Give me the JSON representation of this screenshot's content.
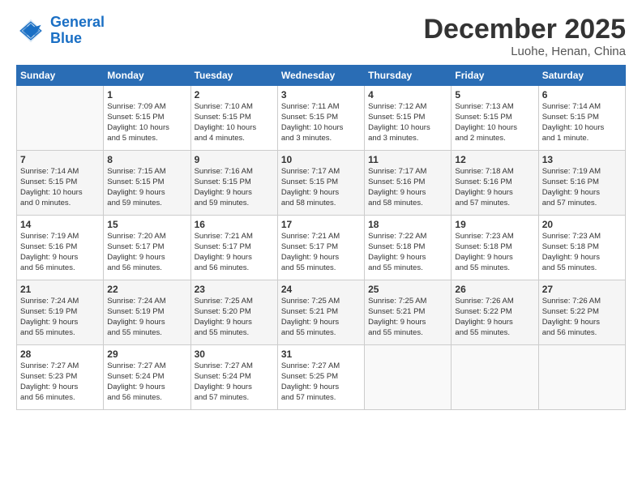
{
  "logo": {
    "line1": "General",
    "line2": "Blue"
  },
  "title": "December 2025",
  "subtitle": "Luohe, Henan, China",
  "weekdays": [
    "Sunday",
    "Monday",
    "Tuesday",
    "Wednesday",
    "Thursday",
    "Friday",
    "Saturday"
  ],
  "weeks": [
    [
      {
        "day": "",
        "info": ""
      },
      {
        "day": "1",
        "info": "Sunrise: 7:09 AM\nSunset: 5:15 PM\nDaylight: 10 hours\nand 5 minutes."
      },
      {
        "day": "2",
        "info": "Sunrise: 7:10 AM\nSunset: 5:15 PM\nDaylight: 10 hours\nand 4 minutes."
      },
      {
        "day": "3",
        "info": "Sunrise: 7:11 AM\nSunset: 5:15 PM\nDaylight: 10 hours\nand 3 minutes."
      },
      {
        "day": "4",
        "info": "Sunrise: 7:12 AM\nSunset: 5:15 PM\nDaylight: 10 hours\nand 3 minutes."
      },
      {
        "day": "5",
        "info": "Sunrise: 7:13 AM\nSunset: 5:15 PM\nDaylight: 10 hours\nand 2 minutes."
      },
      {
        "day": "6",
        "info": "Sunrise: 7:14 AM\nSunset: 5:15 PM\nDaylight: 10 hours\nand 1 minute."
      }
    ],
    [
      {
        "day": "7",
        "info": "Sunrise: 7:14 AM\nSunset: 5:15 PM\nDaylight: 10 hours\nand 0 minutes."
      },
      {
        "day": "8",
        "info": "Sunrise: 7:15 AM\nSunset: 5:15 PM\nDaylight: 9 hours\nand 59 minutes."
      },
      {
        "day": "9",
        "info": "Sunrise: 7:16 AM\nSunset: 5:15 PM\nDaylight: 9 hours\nand 59 minutes."
      },
      {
        "day": "10",
        "info": "Sunrise: 7:17 AM\nSunset: 5:15 PM\nDaylight: 9 hours\nand 58 minutes."
      },
      {
        "day": "11",
        "info": "Sunrise: 7:17 AM\nSunset: 5:16 PM\nDaylight: 9 hours\nand 58 minutes."
      },
      {
        "day": "12",
        "info": "Sunrise: 7:18 AM\nSunset: 5:16 PM\nDaylight: 9 hours\nand 57 minutes."
      },
      {
        "day": "13",
        "info": "Sunrise: 7:19 AM\nSunset: 5:16 PM\nDaylight: 9 hours\nand 57 minutes."
      }
    ],
    [
      {
        "day": "14",
        "info": "Sunrise: 7:19 AM\nSunset: 5:16 PM\nDaylight: 9 hours\nand 56 minutes."
      },
      {
        "day": "15",
        "info": "Sunrise: 7:20 AM\nSunset: 5:17 PM\nDaylight: 9 hours\nand 56 minutes."
      },
      {
        "day": "16",
        "info": "Sunrise: 7:21 AM\nSunset: 5:17 PM\nDaylight: 9 hours\nand 56 minutes."
      },
      {
        "day": "17",
        "info": "Sunrise: 7:21 AM\nSunset: 5:17 PM\nDaylight: 9 hours\nand 55 minutes."
      },
      {
        "day": "18",
        "info": "Sunrise: 7:22 AM\nSunset: 5:18 PM\nDaylight: 9 hours\nand 55 minutes."
      },
      {
        "day": "19",
        "info": "Sunrise: 7:23 AM\nSunset: 5:18 PM\nDaylight: 9 hours\nand 55 minutes."
      },
      {
        "day": "20",
        "info": "Sunrise: 7:23 AM\nSunset: 5:18 PM\nDaylight: 9 hours\nand 55 minutes."
      }
    ],
    [
      {
        "day": "21",
        "info": "Sunrise: 7:24 AM\nSunset: 5:19 PM\nDaylight: 9 hours\nand 55 minutes."
      },
      {
        "day": "22",
        "info": "Sunrise: 7:24 AM\nSunset: 5:19 PM\nDaylight: 9 hours\nand 55 minutes."
      },
      {
        "day": "23",
        "info": "Sunrise: 7:25 AM\nSunset: 5:20 PM\nDaylight: 9 hours\nand 55 minutes."
      },
      {
        "day": "24",
        "info": "Sunrise: 7:25 AM\nSunset: 5:21 PM\nDaylight: 9 hours\nand 55 minutes."
      },
      {
        "day": "25",
        "info": "Sunrise: 7:25 AM\nSunset: 5:21 PM\nDaylight: 9 hours\nand 55 minutes."
      },
      {
        "day": "26",
        "info": "Sunrise: 7:26 AM\nSunset: 5:22 PM\nDaylight: 9 hours\nand 55 minutes."
      },
      {
        "day": "27",
        "info": "Sunrise: 7:26 AM\nSunset: 5:22 PM\nDaylight: 9 hours\nand 56 minutes."
      }
    ],
    [
      {
        "day": "28",
        "info": "Sunrise: 7:27 AM\nSunset: 5:23 PM\nDaylight: 9 hours\nand 56 minutes."
      },
      {
        "day": "29",
        "info": "Sunrise: 7:27 AM\nSunset: 5:24 PM\nDaylight: 9 hours\nand 56 minutes."
      },
      {
        "day": "30",
        "info": "Sunrise: 7:27 AM\nSunset: 5:24 PM\nDaylight: 9 hours\nand 57 minutes."
      },
      {
        "day": "31",
        "info": "Sunrise: 7:27 AM\nSunset: 5:25 PM\nDaylight: 9 hours\nand 57 minutes."
      },
      {
        "day": "",
        "info": ""
      },
      {
        "day": "",
        "info": ""
      },
      {
        "day": "",
        "info": ""
      }
    ]
  ]
}
